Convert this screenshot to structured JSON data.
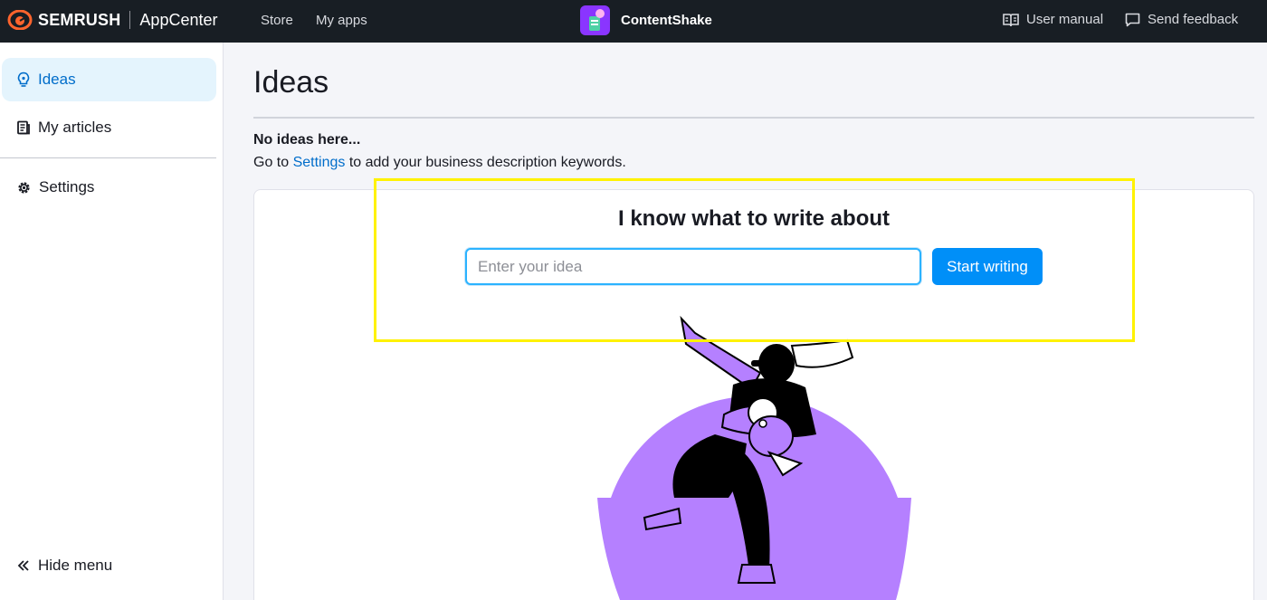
{
  "topbar": {
    "brand": "SEMRUSH",
    "app_center": "AppCenter",
    "nav": [
      "Store",
      "My apps"
    ],
    "product_name": "ContentShake",
    "user_manual": "User manual",
    "send_feedback": "Send feedback",
    "colors": {
      "background": "#181e24",
      "brand_orange": "#ff642d",
      "product_purple": "#8a35ff"
    }
  },
  "sidebar": {
    "items": [
      {
        "label": "Ideas",
        "icon": "lightbulb-icon",
        "active": true
      },
      {
        "label": "My articles",
        "icon": "articles-icon",
        "active": false
      },
      {
        "label": "Settings",
        "icon": "gear-icon",
        "active": false
      }
    ],
    "hide_menu": "Hide menu",
    "hide_menu_icon": "double-chevron-left-icon"
  },
  "main": {
    "title": "Ideas",
    "empty_title": "No ideas here...",
    "empty_desc_prefix": "Go to ",
    "empty_desc_link": "Settings",
    "empty_desc_suffix": " to add your business description keywords.",
    "card": {
      "heading": "I know what to write about",
      "input_placeholder": "Enter your idea",
      "input_value": "",
      "button_label": "Start writing",
      "colors": {
        "button": "#008ff8",
        "illustration": "#b580ff",
        "highlight": "#fff200"
      }
    }
  }
}
